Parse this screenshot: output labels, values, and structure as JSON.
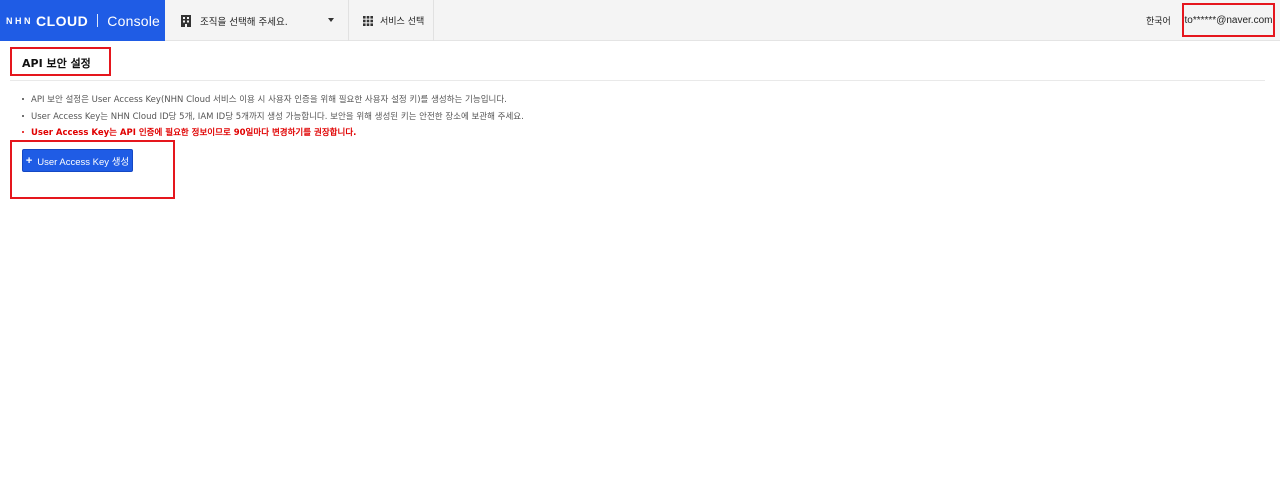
{
  "brand": {
    "nhn": "NHN",
    "cloud": "CLOUD",
    "console": "Console"
  },
  "header": {
    "org_select_label": "조직을 선택해 주세요.",
    "service_select_label": "서비스 선택",
    "language": "한국어",
    "user_email": "to******@naver.com"
  },
  "page": {
    "title": "API 보안 설정",
    "notes": [
      "API 보안 설정은 User Access Key(NHN Cloud 서비스 이용 시 사용자 인증을 위해 필요한 사용자 설정 키)를 생성하는 기능입니다.",
      "User Access Key는 NHN Cloud ID당 5개, IAM ID당 5개까지 생성 가능합니다. 보안을 위해 생성된 키는 안전한 장소에 보관해 주세요.",
      "User Access Key는 API 인증에 필요한 정보이므로 90일마다 변경하기를 권장합니다."
    ],
    "create_button": {
      "plus": "+",
      "label": "User Access Key 생성"
    }
  },
  "colors": {
    "brand_blue": "#1f5ce5",
    "highlight_red": "#e5161d",
    "warning_red": "#e00000"
  }
}
